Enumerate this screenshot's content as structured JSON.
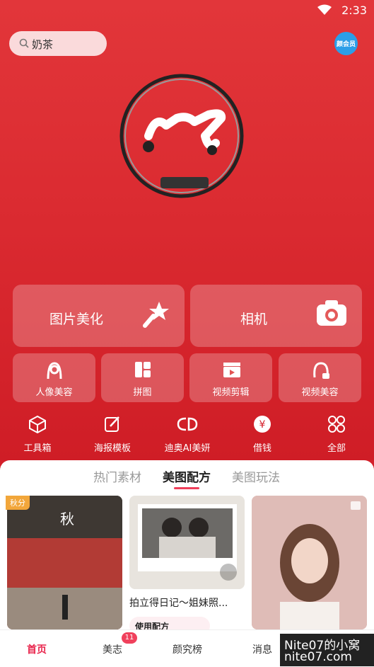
{
  "status": {
    "time": "2:33"
  },
  "search": {
    "text": "奶茶"
  },
  "avatar": {
    "label": "颜会员"
  },
  "big_tiles": [
    {
      "label": "图片美化"
    },
    {
      "label": "相机"
    }
  ],
  "small_tiles": [
    {
      "label": "人像美容"
    },
    {
      "label": "拼图"
    },
    {
      "label": "视频剪辑"
    },
    {
      "label": "视频美容"
    }
  ],
  "tools": [
    {
      "label": "工具箱"
    },
    {
      "label": "海报模板"
    },
    {
      "label": "迪奥AI美妍"
    },
    {
      "label": "借钱"
    },
    {
      "label": "全部"
    }
  ],
  "tabs": [
    {
      "label": "热门素材"
    },
    {
      "label": "美图配方"
    },
    {
      "label": "美图玩法"
    }
  ],
  "feed": {
    "tag": "秋分",
    "caption": "拍立得日记～姐妹照...",
    "pill": "使用配方"
  },
  "nav": [
    {
      "label": "首页"
    },
    {
      "label": "美志"
    },
    {
      "label": "颜究榜"
    },
    {
      "label": "消息"
    }
  ],
  "nav_badge": "11",
  "watermark": {
    "line1": "Nite07的小窝",
    "line2": "nite07.com"
  },
  "colors": {
    "brand_red": "#d41f2a",
    "active_pink": "#e8224a",
    "tag_orange": "#f2a63a"
  }
}
